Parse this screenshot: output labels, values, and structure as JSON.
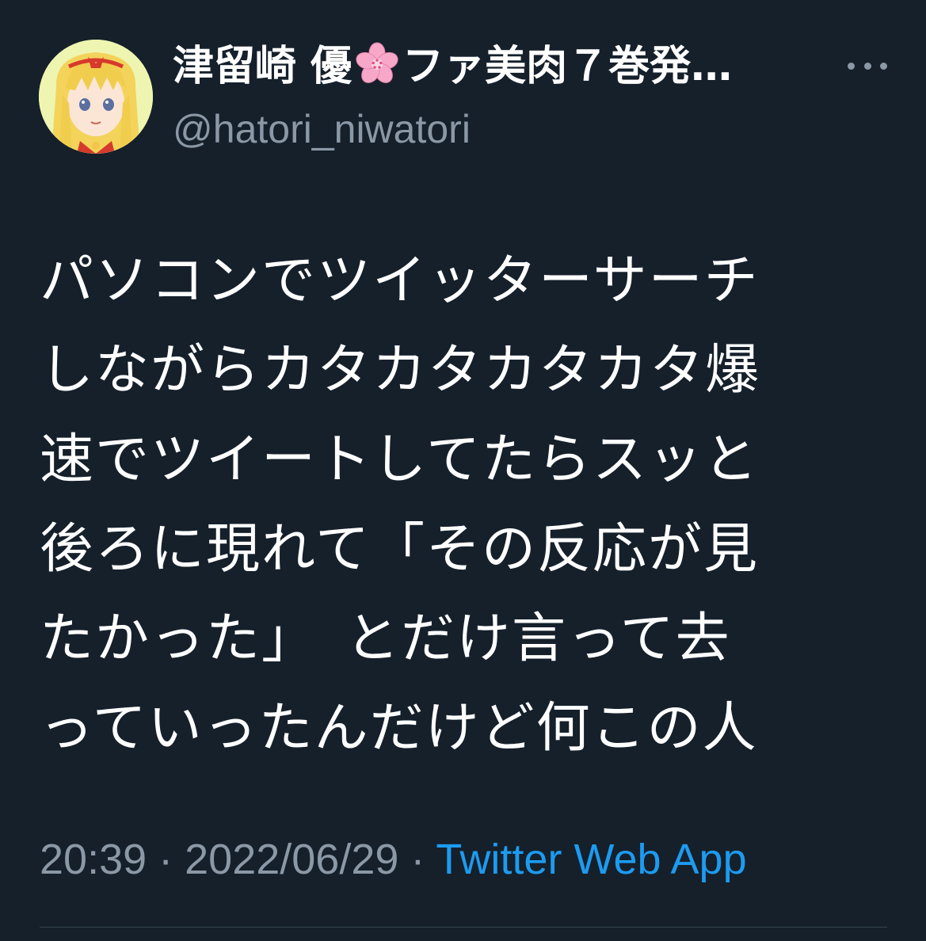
{
  "user": {
    "display_name_part1": "津留崎 優",
    "flower_icon": "cherry-blossom",
    "display_name_part2": "ファ美肉７巻発…",
    "handle": "@hatori_niwatori",
    "avatar_icon": "anime-girl-avatar"
  },
  "tweet": {
    "lines": [
      "パソコンでツイッターサーチ",
      "しながらカタカタカタカタ爆",
      "速でツイートしてたらスッと",
      "後ろに現れて「その反応が見",
      "たかった」　とだけ言って去",
      "っていったんだけど何この人"
    ]
  },
  "meta": {
    "time": "20:39",
    "separator1": " · ",
    "date": "2022/06/29",
    "separator2": " · ",
    "source": "Twitter Web App"
  },
  "colors": {
    "background": "#15202b",
    "text": "#ffffff",
    "secondary": "#8b98a5",
    "link": "#1d9bf0"
  }
}
